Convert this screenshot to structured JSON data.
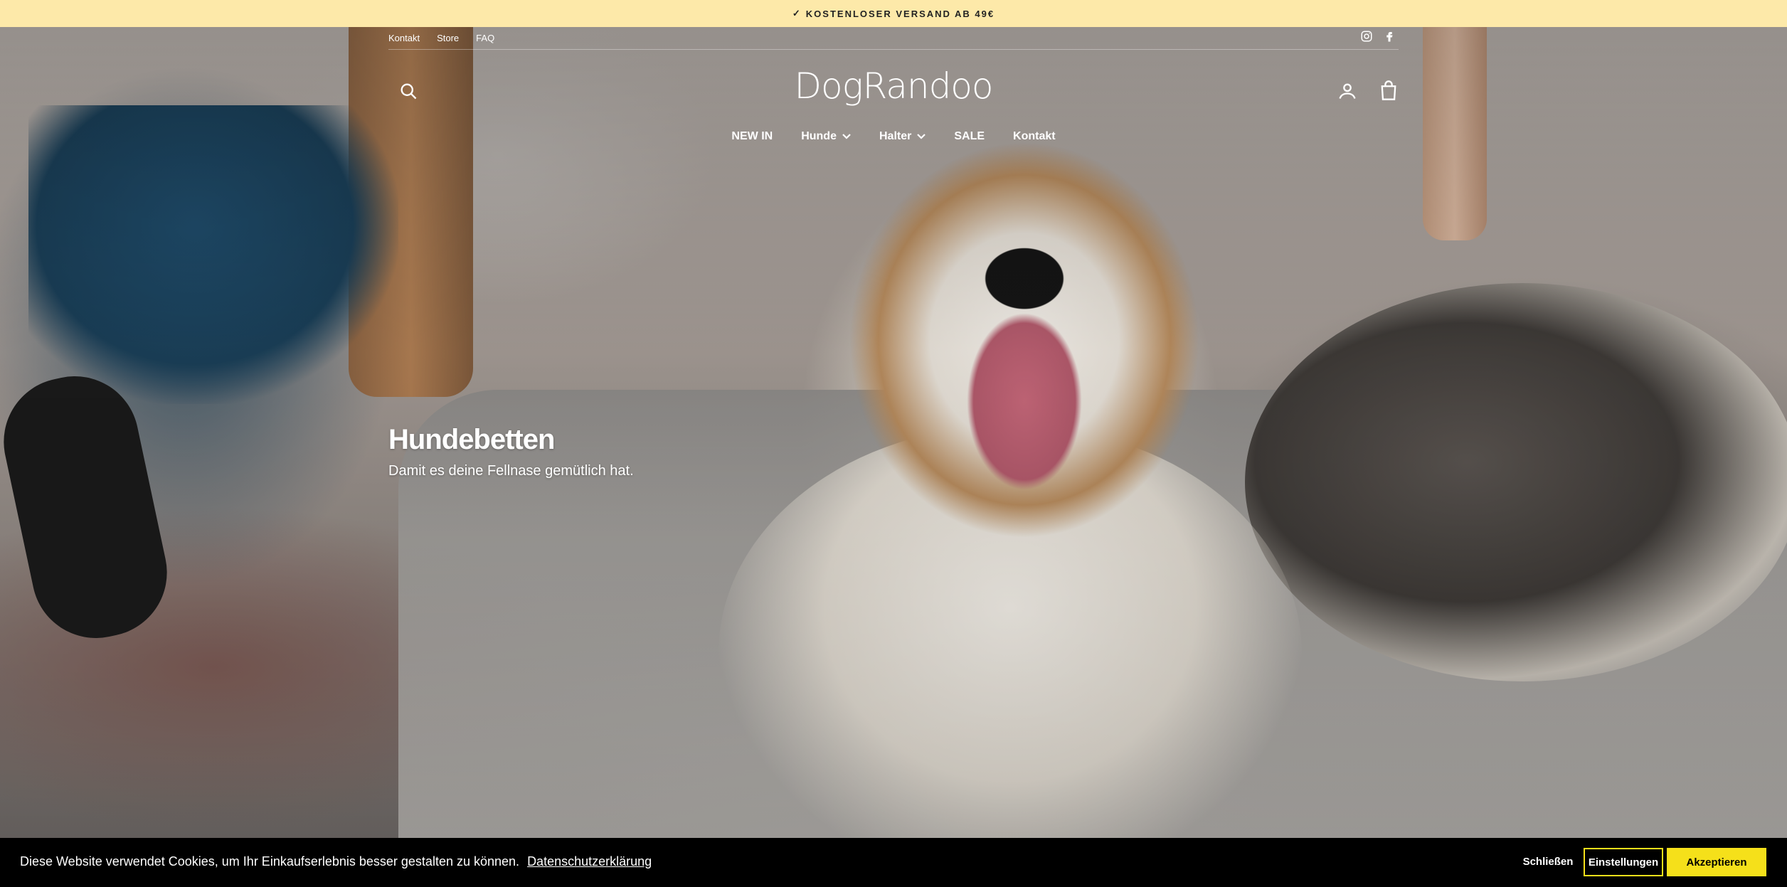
{
  "announcement": {
    "check": "✓",
    "text": "KOSTENLOSER VERSAND AB 49€"
  },
  "utility_nav": [
    "Kontakt",
    "Store",
    "FAQ"
  ],
  "social": {
    "instagram_icon": "instagram-icon",
    "facebook_icon": "facebook-icon"
  },
  "logo": "DogRandoo",
  "main_nav": [
    {
      "label": "NEW IN",
      "dropdown": false
    },
    {
      "label": "Hunde",
      "dropdown": true
    },
    {
      "label": "Halter",
      "dropdown": true
    },
    {
      "label": "SALE",
      "dropdown": false
    },
    {
      "label": "Kontakt",
      "dropdown": false
    }
  ],
  "hero": {
    "title": "Hundebetten",
    "subtitle": "Damit es deine Fellnase gemütlich hat."
  },
  "cookie": {
    "message": "Diese Website verwendet Cookies, um Ihr Einkaufserlebnis besser gestalten zu können.",
    "privacy_link": "Datenschutzerklärung",
    "close": "Schließen",
    "settings": "Einstellungen",
    "accept": "Akzeptieren"
  },
  "colors": {
    "announcement_bg": "#fde9a9",
    "accent": "#f5e01a",
    "cookie_bg": "#000000"
  }
}
